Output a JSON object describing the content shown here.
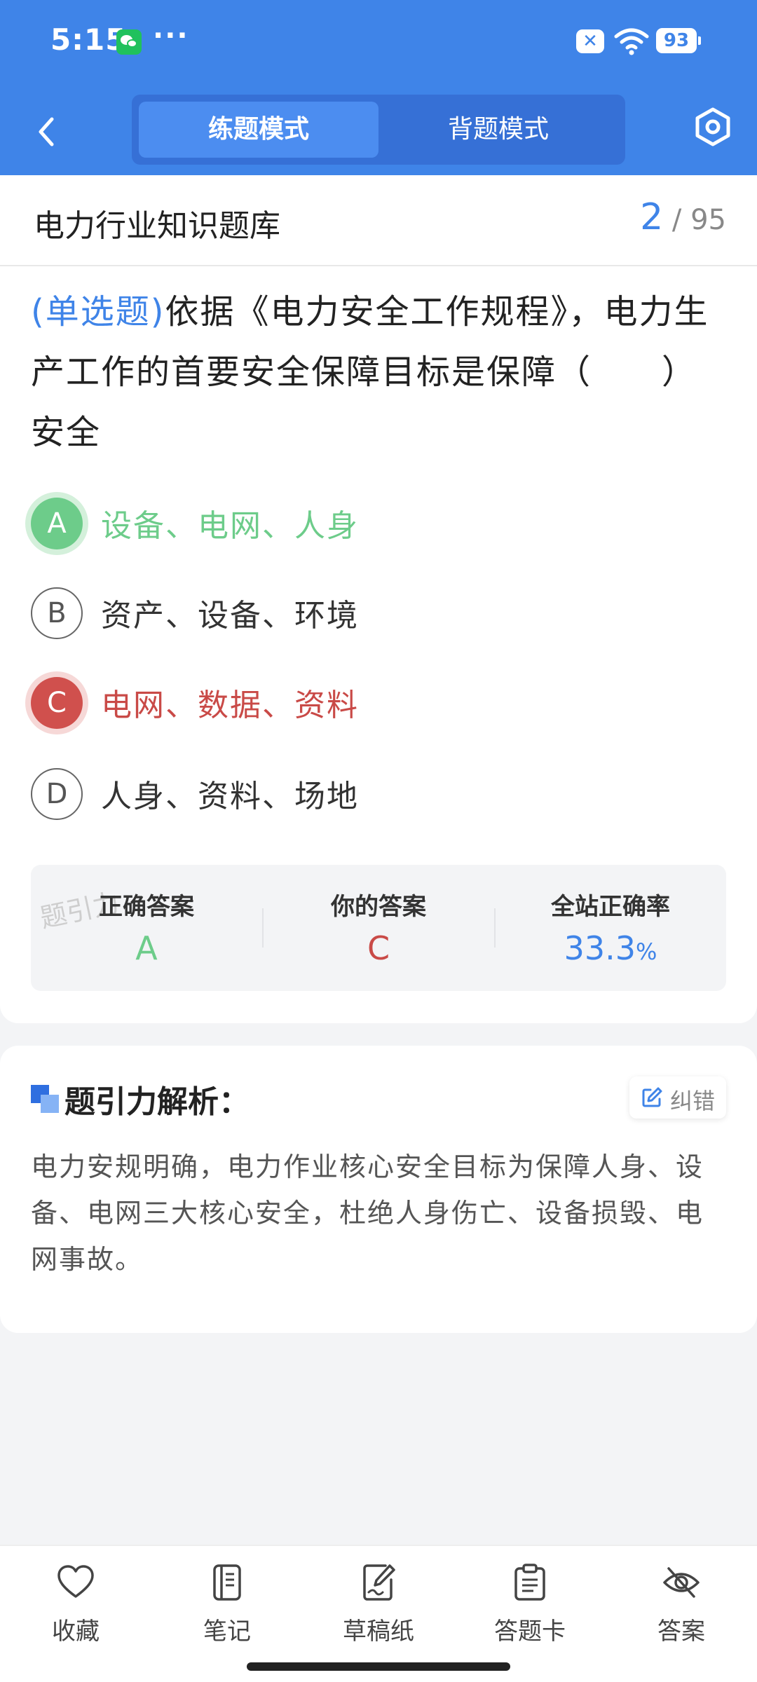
{
  "status_bar": {
    "time": "5:15",
    "more": "···",
    "battery": "93"
  },
  "nav": {
    "tab_practice": "练题模式",
    "tab_memorize": "背题模式"
  },
  "bank": {
    "title": "电力行业知识题库",
    "current": "2",
    "total": "/ 95"
  },
  "question": {
    "type": "(单选题)",
    "text": "依据《电力安全工作规程》，电力生产工作的首要安全保障目标是保障（　　）安全"
  },
  "options": [
    {
      "letter": "A",
      "text": "设备、电网、人身",
      "state": "correct"
    },
    {
      "letter": "B",
      "text": "资产、设备、环境",
      "state": "normal"
    },
    {
      "letter": "C",
      "text": "电网、数据、资料",
      "state": "wrong"
    },
    {
      "letter": "D",
      "text": "人身、资料、场地",
      "state": "normal"
    }
  ],
  "stats": {
    "correct_label": "正确答案",
    "correct_value": "A",
    "yours_label": "你的答案",
    "yours_value": "C",
    "rate_label": "全站正确率",
    "rate_value": "33.3",
    "rate_unit": "%",
    "watermark": "题引力"
  },
  "analysis": {
    "title": "题引力解析：",
    "report_label": "纠错",
    "text": "电力安规明确，电力作业核心安全目标为保障人身、设备、电网三大核心安全，杜绝人身伤亡、设备损毁、电网事故。"
  },
  "toolbar": {
    "favorite": "收藏",
    "notes": "笔记",
    "draft": "草稿纸",
    "answer_card": "答题卡",
    "answer": "答案"
  },
  "colors": {
    "primary": "#3f84e8",
    "correct": "#6dcc8a",
    "wrong": "#d0504d"
  }
}
